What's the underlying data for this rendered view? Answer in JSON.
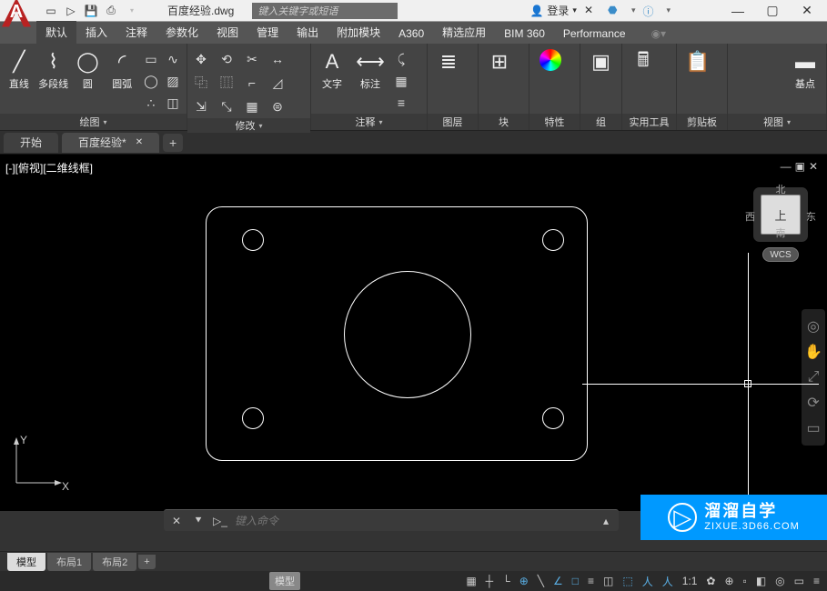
{
  "title": "百度经验.dwg",
  "search_placeholder": "键入关键字或短语",
  "login": "登录",
  "menutabs": [
    "默认",
    "插入",
    "注释",
    "参数化",
    "视图",
    "管理",
    "输出",
    "附加模块",
    "A360",
    "精选应用",
    "BIM 360",
    "Performance"
  ],
  "panels": {
    "draw": {
      "title": "绘图",
      "items": [
        "直线",
        "多段线",
        "圆",
        "圆弧"
      ]
    },
    "modify": {
      "title": "修改"
    },
    "annot": {
      "title": "注释",
      "items": [
        "文字",
        "标注"
      ]
    },
    "layers": {
      "title": "图层"
    },
    "blocks": {
      "title": "块"
    },
    "props": {
      "title": "特性"
    },
    "groups": {
      "title": "组"
    },
    "util": {
      "title": "实用工具"
    },
    "clip": {
      "title": "剪贴板"
    },
    "view": {
      "title": "视图",
      "item": "基点"
    }
  },
  "filetabs": {
    "start": "开始",
    "current": "百度经验*"
  },
  "view_caption": "[-][俯视][二维线框]",
  "navcube": {
    "top": "上",
    "n": "北",
    "s": "南",
    "e": "东",
    "w": "西",
    "wcs": "WCS"
  },
  "ucs": {
    "x": "X",
    "y": "Y"
  },
  "cmd_placeholder": "键入命令",
  "layouts": {
    "model": "模型",
    "l1": "布局1",
    "l2": "布局2"
  },
  "status_model": "模型",
  "status_scale": "1:1",
  "watermark": {
    "title": "溜溜自学",
    "url": "ZIXUE.3D66.COM"
  }
}
